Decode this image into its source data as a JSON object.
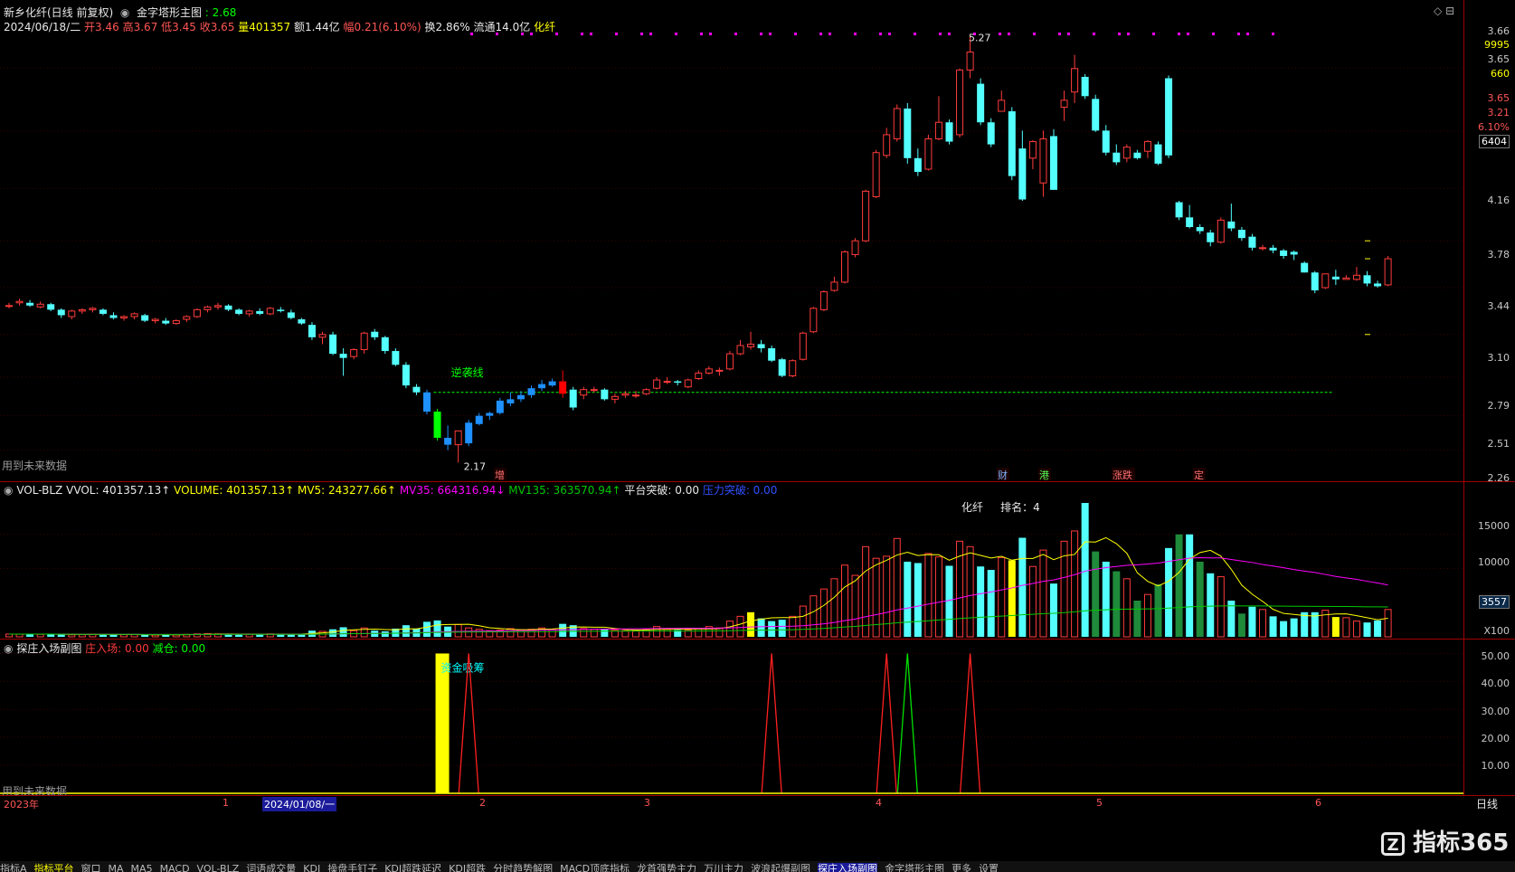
{
  "header": {
    "stock_title": "新乡化纤(日线 前复权)",
    "indicator_name": "金字塔形主图",
    "indicator_value": ": 2.68",
    "date": "2024/06/18/二",
    "open": "开3.46",
    "high": "高3.67",
    "low": "低3.45",
    "close": "收3.65",
    "volume": "量401357",
    "amount": "额1.44亿",
    "change": "幅0.21(6.10%)",
    "turnover": "换2.86%",
    "float_cap": "流通14.0亿",
    "tag": "化纤"
  },
  "main_axis": {
    "top_labels": [
      "3.66",
      "9995",
      "3.65",
      "660",
      "3.65",
      "3.21",
      "6.10%",
      "6404"
    ],
    "ticks": [
      "4.16",
      "3.78",
      "3.44",
      "3.10",
      "2.79",
      "2.51",
      "2.26"
    ]
  },
  "annotations": {
    "high_label": "5.27",
    "low_label": "2.17",
    "reverse_line_label": "逆袭线",
    "future_data": "用到未来数据",
    "events": [
      "增",
      "财",
      "港",
      "涨跌",
      "定"
    ]
  },
  "volume_header": {
    "name": "VOL-BLZ",
    "vvol": "VVOL: 401357.13↑",
    "volume": "VOLUME: 401357.13↑",
    "mv5": "MV5: 243277.66↑",
    "mv35": "MV35: 664316.94↓",
    "mv135": "MV135: 363570.94↑",
    "platform": "平台突破: 0.00",
    "pressure": "压力突破: 0.00",
    "rank_name": "化纤",
    "rank": "排名：4"
  },
  "volume_axis": {
    "ticks": [
      "15000",
      "10000"
    ],
    "current": "3557",
    "unit": "X100"
  },
  "sub_header": {
    "name": "探庄入场副图",
    "enter": "庄入场: 0.00",
    "reduce": "减仓: 0.00",
    "signal_label": "资金吸筹"
  },
  "sub_axis": {
    "ticks": [
      "50.00",
      "40.00",
      "30.00",
      "20.00",
      "10.00"
    ]
  },
  "timeline": {
    "labels": [
      "2023年",
      "1",
      "2024/01/08/一",
      "2",
      "3",
      "4",
      "5",
      "6"
    ],
    "period": "日线"
  },
  "tabs": [
    "指标A",
    "指标平台",
    "窗口",
    "MA",
    "MA5",
    "MACD",
    "VOL-BLZ",
    "词语成交量",
    "KDJ",
    "操盘手钉子",
    "KDJ超跌延迟",
    "KDJ超跌",
    "分时趋势解图",
    "MACD顶底指标",
    "龙首强势主力",
    "万川主力",
    "波浪起爆副图",
    "探庄入场副图",
    "金字塔形主图",
    "更多",
    "设置"
  ],
  "watermark": "指标365",
  "colors": {
    "up": "#ff3b3b",
    "down": "#54ffff",
    "ma5": "#ffff00",
    "ma35": "#ff00ff",
    "ma135": "#00c800"
  },
  "chart_data": [
    {
      "type": "candlestick",
      "title": "新乡化纤(日线 前复权)",
      "note": "Approximate daily OHLC read off the chart; ~128 sessions",
      "ohlc": [
        [
          3.31,
          3.33,
          3.29,
          3.31
        ],
        [
          3.33,
          3.36,
          3.31,
          3.34
        ],
        [
          3.33,
          3.35,
          3.3,
          3.31
        ],
        [
          3.3,
          3.34,
          3.29,
          3.32
        ],
        [
          3.32,
          3.33,
          3.27,
          3.28
        ],
        [
          3.28,
          3.29,
          3.22,
          3.24
        ],
        [
          3.23,
          3.28,
          3.21,
          3.27
        ],
        [
          3.27,
          3.29,
          3.25,
          3.28
        ],
        [
          3.28,
          3.3,
          3.26,
          3.29
        ],
        [
          3.28,
          3.29,
          3.24,
          3.25
        ],
        [
          3.24,
          3.26,
          3.21,
          3.22
        ],
        [
          3.22,
          3.24,
          3.2,
          3.23
        ],
        [
          3.23,
          3.26,
          3.21,
          3.25
        ],
        [
          3.24,
          3.25,
          3.19,
          3.2
        ],
        [
          3.2,
          3.22,
          3.18,
          3.21
        ],
        [
          3.2,
          3.22,
          3.17,
          3.18
        ],
        [
          3.18,
          3.21,
          3.17,
          3.2
        ],
        [
          3.21,
          3.24,
          3.19,
          3.23
        ],
        [
          3.23,
          3.29,
          3.22,
          3.28
        ],
        [
          3.28,
          3.31,
          3.26,
          3.3
        ],
        [
          3.3,
          3.33,
          3.28,
          3.31
        ],
        [
          3.31,
          3.32,
          3.27,
          3.28
        ],
        [
          3.28,
          3.29,
          3.24,
          3.25
        ],
        [
          3.25,
          3.28,
          3.23,
          3.27
        ],
        [
          3.27,
          3.29,
          3.24,
          3.25
        ],
        [
          3.25,
          3.3,
          3.24,
          3.29
        ],
        [
          3.28,
          3.3,
          3.26,
          3.27
        ],
        [
          3.26,
          3.28,
          3.21,
          3.22
        ],
        [
          3.21,
          3.22,
          3.17,
          3.18
        ],
        [
          3.17,
          3.19,
          3.06,
          3.08
        ],
        [
          3.08,
          3.12,
          3.03,
          3.1
        ],
        [
          3.1,
          3.12,
          2.95,
          2.96
        ],
        [
          2.96,
          3.0,
          2.8,
          2.93
        ],
        [
          2.94,
          3.0,
          2.92,
          2.99
        ],
        [
          2.99,
          3.12,
          2.96,
          3.11
        ],
        [
          3.12,
          3.14,
          3.06,
          3.08
        ],
        [
          3.08,
          3.09,
          2.96,
          2.98
        ],
        [
          2.98,
          3.0,
          2.87,
          2.88
        ],
        [
          2.88,
          2.9,
          2.71,
          2.73
        ],
        [
          2.72,
          2.74,
          2.66,
          2.68
        ],
        [
          2.68,
          2.7,
          2.52,
          2.54
        ],
        [
          2.54,
          2.56,
          2.33,
          2.35
        ],
        [
          2.35,
          2.44,
          2.26,
          2.3
        ],
        [
          2.3,
          2.38,
          2.17,
          2.4
        ],
        [
          2.31,
          2.48,
          2.29,
          2.46
        ],
        [
          2.45,
          2.53,
          2.44,
          2.51
        ],
        [
          2.51,
          2.54,
          2.48,
          2.53
        ],
        [
          2.53,
          2.64,
          2.52,
          2.62
        ],
        [
          2.6,
          2.68,
          2.58,
          2.63
        ],
        [
          2.63,
          2.69,
          2.61,
          2.66
        ],
        [
          2.66,
          2.73,
          2.64,
          2.71
        ],
        [
          2.71,
          2.77,
          2.69,
          2.74
        ],
        [
          2.73,
          2.78,
          2.72,
          2.76
        ],
        [
          2.76,
          2.84,
          2.64,
          2.67
        ],
        [
          2.7,
          2.72,
          2.55,
          2.57
        ],
        [
          2.66,
          2.72,
          2.63,
          2.7
        ],
        [
          2.7,
          2.72,
          2.68,
          2.7
        ],
        [
          2.7,
          2.71,
          2.62,
          2.63
        ],
        [
          2.63,
          2.67,
          2.6,
          2.65
        ],
        [
          2.66,
          2.69,
          2.64,
          2.67
        ],
        [
          2.66,
          2.69,
          2.64,
          2.66
        ],
        [
          2.67,
          2.71,
          2.66,
          2.7
        ],
        [
          2.71,
          2.79,
          2.7,
          2.77
        ],
        [
          2.76,
          2.79,
          2.74,
          2.76
        ],
        [
          2.76,
          2.77,
          2.73,
          2.75
        ],
        [
          2.72,
          2.78,
          2.71,
          2.77
        ],
        [
          2.78,
          2.84,
          2.77,
          2.82
        ],
        [
          2.82,
          2.87,
          2.81,
          2.85
        ],
        [
          2.84,
          2.86,
          2.8,
          2.84
        ],
        [
          2.85,
          2.98,
          2.84,
          2.96
        ],
        [
          2.96,
          3.06,
          2.95,
          3.02
        ],
        [
          3.01,
          3.12,
          2.99,
          3.03
        ],
        [
          3.03,
          3.06,
          2.97,
          3.0
        ],
        [
          3.0,
          3.02,
          2.9,
          2.91
        ],
        [
          2.92,
          2.93,
          2.79,
          2.8
        ],
        [
          2.8,
          2.92,
          2.79,
          2.91
        ],
        [
          2.92,
          3.12,
          2.91,
          3.11
        ],
        [
          3.12,
          3.3,
          3.11,
          3.29
        ],
        [
          3.28,
          3.42,
          3.27,
          3.41
        ],
        [
          3.42,
          3.52,
          3.41,
          3.48
        ],
        [
          3.48,
          3.71,
          3.47,
          3.7
        ],
        [
          3.68,
          3.8,
          3.66,
          3.78
        ],
        [
          3.78,
          4.15,
          3.77,
          4.14
        ],
        [
          4.1,
          4.44,
          4.09,
          4.42
        ],
        [
          4.4,
          4.6,
          4.38,
          4.55
        ],
        [
          4.52,
          4.77,
          4.5,
          4.74
        ],
        [
          4.74,
          4.78,
          4.34,
          4.38
        ],
        [
          4.38,
          4.45,
          4.25,
          4.28
        ],
        [
          4.3,
          4.55,
          4.29,
          4.52
        ],
        [
          4.52,
          4.83,
          4.51,
          4.64
        ],
        [
          4.64,
          4.66,
          4.48,
          4.5
        ],
        [
          4.55,
          5.03,
          4.53,
          5.02
        ],
        [
          5.02,
          5.27,
          4.96,
          5.15
        ],
        [
          4.92,
          4.96,
          4.62,
          4.64
        ],
        [
          4.64,
          4.67,
          4.46,
          4.48
        ],
        [
          4.72,
          4.87,
          4.72,
          4.8
        ],
        [
          4.72,
          4.75,
          4.22,
          4.25
        ],
        [
          4.45,
          4.58,
          4.07,
          4.08
        ],
        [
          4.38,
          4.51,
          4.3,
          4.5
        ],
        [
          4.2,
          4.58,
          4.1,
          4.52
        ],
        [
          4.54,
          4.59,
          4.15,
          4.15
        ],
        [
          4.75,
          4.87,
          4.65,
          4.8
        ],
        [
          4.86,
          5.13,
          4.78,
          5.03
        ],
        [
          4.97,
          4.99,
          4.81,
          4.83
        ],
        [
          4.81,
          4.84,
          4.57,
          4.58
        ],
        [
          4.58,
          4.62,
          4.4,
          4.42
        ],
        [
          4.42,
          4.48,
          4.33,
          4.35
        ],
        [
          4.38,
          4.48,
          4.35,
          4.46
        ],
        [
          4.42,
          4.44,
          4.37,
          4.38
        ],
        [
          4.43,
          4.51,
          4.38,
          4.5
        ],
        [
          4.48,
          4.5,
          4.33,
          4.34
        ],
        [
          4.96,
          4.98,
          4.38,
          4.4
        ],
        [
          4.06,
          4.07,
          3.93,
          3.95
        ],
        [
          3.95,
          4.04,
          3.87,
          3.88
        ],
        [
          3.88,
          3.9,
          3.83,
          3.85
        ],
        [
          3.84,
          3.86,
          3.74,
          3.77
        ],
        [
          3.77,
          3.95,
          3.76,
          3.93
        ],
        [
          3.92,
          4.05,
          3.85,
          3.87
        ],
        [
          3.86,
          3.88,
          3.78,
          3.8
        ],
        [
          3.81,
          3.83,
          3.71,
          3.73
        ],
        [
          3.73,
          3.75,
          3.71,
          3.73
        ],
        [
          3.73,
          3.75,
          3.69,
          3.71
        ],
        [
          3.71,
          3.72,
          3.65,
          3.67
        ],
        [
          3.7,
          3.71,
          3.64,
          3.68
        ],
        [
          3.62,
          3.63,
          3.55,
          3.55
        ],
        [
          3.55,
          3.56,
          3.4,
          3.42
        ],
        [
          3.44,
          3.54,
          3.43,
          3.54
        ],
        [
          3.52,
          3.57,
          3.46,
          3.5
        ],
        [
          3.5,
          3.53,
          3.5,
          3.51
        ],
        [
          3.5,
          3.59,
          3.49,
          3.53
        ],
        [
          3.53,
          3.56,
          3.45,
          3.47
        ],
        [
          3.47,
          3.49,
          3.44,
          3.45
        ],
        [
          3.46,
          3.67,
          3.45,
          3.65
        ]
      ],
      "reference_line": 2.68,
      "high": 5.27,
      "low": 2.17,
      "ylim": [
        2.17,
        5.27
      ]
    },
    {
      "type": "bar",
      "title": "VOL-BLZ",
      "unit": "X100",
      "ylim": [
        0,
        20000
      ],
      "values": [
        400,
        380,
        420,
        360,
        420,
        340,
        300,
        320,
        380,
        360,
        300,
        320,
        330,
        300,
        280,
        310,
        300,
        350,
        420,
        460,
        420,
        380,
        340,
        360,
        380,
        420,
        400,
        360,
        420,
        900,
        800,
        1100,
        1400,
        900,
        1300,
        900,
        800,
        1200,
        1700,
        1200,
        2200,
        2400,
        1500,
        1800,
        1300,
        1100,
        900,
        1000,
        1200,
        1000,
        1100,
        1300,
        1100,
        1900,
        1700,
        1200,
        1100,
        1100,
        1000,
        900,
        900,
        1100,
        1500,
        1100,
        1000,
        1000,
        1200,
        1500,
        1300,
        2300,
        3000,
        3600,
        2700,
        2300,
        2500,
        3000,
        4500,
        6000,
        7000,
        8500,
        10500,
        9000,
        13200,
        11500,
        11800,
        14400,
        11000,
        10800,
        12200,
        11700,
        10400,
        14000,
        13200,
        10300,
        9800,
        11600,
        11200,
        14500,
        10300,
        12700,
        7800,
        14000,
        15500,
        19600,
        12500,
        11000,
        9600,
        8500,
        5300,
        6200,
        7700,
        13000,
        15000,
        15000,
        11000,
        9300,
        8800,
        5300,
        3400,
        4400,
        4000,
        3000,
        2300,
        2700,
        3600,
        3600,
        3900,
        2900,
        2800,
        2300,
        2100,
        2400,
        4000
      ],
      "ma5": {
        "name": "MV5",
        "last": 243277.66
      },
      "ma35": {
        "name": "MV35",
        "last": 664316.94
      },
      "ma135": {
        "name": "MV135",
        "last": 363570.94
      }
    },
    {
      "type": "signal",
      "title": "探庄入场副图",
      "ylim": [
        0,
        55
      ],
      "yellow_bars": [
        {
          "index": 41,
          "value": 50
        }
      ],
      "red_peaks": [
        44,
        73,
        84,
        92
      ],
      "green_peaks": [
        86
      ],
      "peak_value": 50
    }
  ]
}
